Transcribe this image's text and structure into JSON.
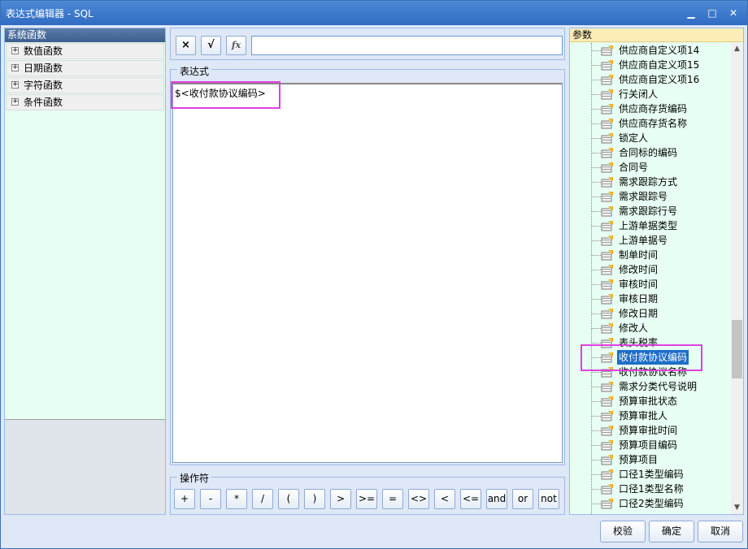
{
  "window": {
    "title": "表达式编辑器 - SQL"
  },
  "left_panel": {
    "header": "系统函数",
    "items": [
      "数值函数",
      "日期函数",
      "字符函数",
      "条件函数"
    ]
  },
  "toolbar": {
    "clear": "×",
    "check": "√",
    "fx": "fx",
    "input_value": ""
  },
  "expression": {
    "label": "表达式",
    "text": "$<收付款协议编码>"
  },
  "operators": {
    "label": "操作符",
    "buttons": [
      "+",
      "-",
      "*",
      "/",
      "(",
      ")",
      ">",
      ">=",
      "=",
      "<>",
      "<",
      "<=",
      "and",
      "or",
      "not"
    ]
  },
  "params": {
    "header": "参数",
    "items": [
      "供应商自定义项14",
      "供应商自定义项15",
      "供应商自定义项16",
      "行关闭人",
      "供应商存货编码",
      "供应商存货名称",
      "锁定人",
      "合同标的编码",
      "合同号",
      "需求跟踪方式",
      "需求跟踪号",
      "需求跟踪行号",
      "上游单据类型",
      "上游单据号",
      "制单时间",
      "修改时间",
      "审核时间",
      "审核日期",
      "修改日期",
      "修改人",
      "表头税率",
      "收付款协议编码",
      "收付款协议名称",
      "需求分类代号说明",
      "预算审批状态",
      "预算审批人",
      "预算审批时间",
      "预算项目编码",
      "预算项目",
      "口径1类型编码",
      "口径1类型名称",
      "口径2类型编码"
    ],
    "selected": "收付款协议编码"
  },
  "buttons": {
    "validate": "校验",
    "ok": "确定",
    "cancel": "取消"
  }
}
